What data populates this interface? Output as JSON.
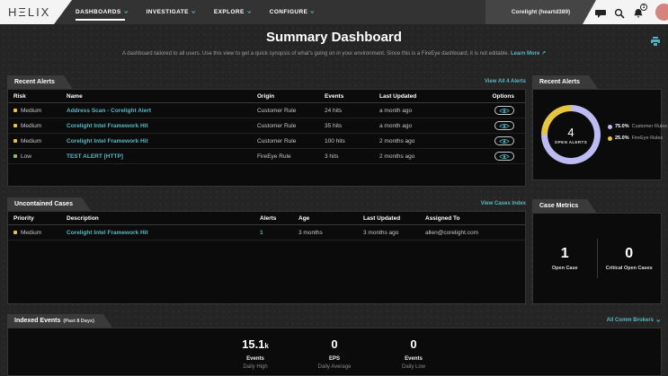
{
  "accent_teal": "#4db3c0",
  "topnav": {
    "logo": "HΞLIX",
    "items": [
      "DASHBOARDS",
      "INVESTIGATE",
      "EXPLORE",
      "CONFIGURE"
    ],
    "account": "Corelight (heartd389)",
    "notification_count": "1"
  },
  "header": {
    "title": "Summary Dashboard",
    "subtitle": "A dashboard tailored to all users. Use this view to get a quick synopsis of what's going on in your environment. Since this is a FireEye dashboard, it is not editable.",
    "learn_more": "Learn More ↗"
  },
  "recent_alerts": {
    "title": "Recent Alerts",
    "view_all": "View All 4 Alerts",
    "columns": {
      "risk": "Risk",
      "name": "Name",
      "origin": "Origin",
      "events": "Events",
      "updated": "Last Updated",
      "options": "Options"
    },
    "rows": [
      {
        "risk": "Medium",
        "risk_color": "#e4c63f",
        "name": "Address Scan - Corelight Alert",
        "origin": "Customer Rule",
        "events": "24 hits",
        "updated": "a month ago"
      },
      {
        "risk": "Medium",
        "risk_color": "#e4c63f",
        "name": "Corelight Intel Framework Hit",
        "origin": "Customer Rule",
        "events": "35 hits",
        "updated": "a month ago"
      },
      {
        "risk": "Medium",
        "risk_color": "#e4c63f",
        "name": "Corelight Intel Framework Hit",
        "origin": "Customer Rule",
        "events": "100 hits",
        "updated": "2 months ago"
      },
      {
        "risk": "Low",
        "risk_color": "#8bc34a",
        "name": "TEST ALERT [HTTP]",
        "origin": "FireEye Rule",
        "events": "3 hits",
        "updated": "2 months ago"
      }
    ]
  },
  "alerts_chart": {
    "title": "Recent Alerts",
    "center_value": "4",
    "center_label": "OPEN ALERTS",
    "chart_data": {
      "type": "pie",
      "categories": [
        "Customer Rules",
        "FireEye Rules"
      ],
      "values": [
        75.0,
        25.0
      ],
      "colors": [
        "#bdbbf2",
        "#e4c63f"
      ],
      "title": "Recent Alerts",
      "center_text": "4 OPEN ALERTS",
      "legend_position": "right"
    },
    "legend": [
      {
        "pct": "75.0%",
        "label": "Customer Rules",
        "color": "#bdbbf2"
      },
      {
        "pct": "25.0%",
        "label": "FireEye Rules",
        "color": "#e4c63f"
      }
    ]
  },
  "uncontained_cases": {
    "title": "Uncontained Cases",
    "view_link": "View Cases Index",
    "columns": {
      "priority": "Priority",
      "description": "Description",
      "alerts": "Alerts",
      "age": "Age",
      "updated": "Last Updated",
      "assigned": "Assigned To"
    },
    "rows": [
      {
        "priority": "Medium",
        "priority_color": "#e4c63f",
        "description": "Corelight Intel Framework Hit",
        "alerts": "1",
        "age": "3 months",
        "updated": "3 months ago",
        "assigned": "allen@corelight.com"
      }
    ]
  },
  "case_metrics": {
    "title": "Case Metrics",
    "stats": [
      {
        "value": "1",
        "label": "Open Case"
      },
      {
        "value": "0",
        "label": "Critical Open Cases"
      }
    ]
  },
  "indexed_events": {
    "title": "Indexed Events",
    "title_suffix": "(Past 8 Days)",
    "filter": "All Comm Brokers",
    "stats": [
      {
        "value": "15.1",
        "unit": "k",
        "label": "Events",
        "sublabel": "Daily High"
      },
      {
        "value": "0",
        "unit": "",
        "label": "EPS",
        "sublabel": "Daily Average"
      },
      {
        "value": "0",
        "unit": "",
        "label": "Events",
        "sublabel": "Daily Low"
      }
    ]
  }
}
